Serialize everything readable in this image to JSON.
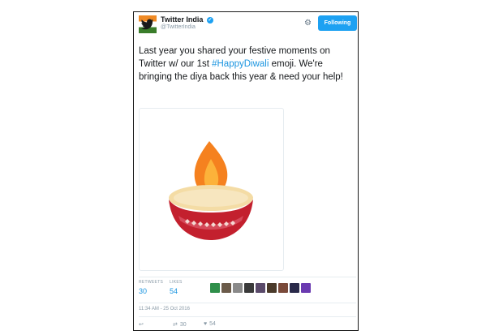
{
  "account": {
    "name": "Twitter India",
    "handle": "@TwitterIndia",
    "follow_label": "Following"
  },
  "tweet": {
    "text_before": "Last year you shared your festive moments on Twitter w/ our 1st ",
    "hashtag": "#HappyDiwali",
    "text_after": " emoji. We're bringing the diya back this year & need your help!"
  },
  "stats": {
    "retweets_label": "RETWEETS",
    "retweets_value": "30",
    "likes_label": "LIKES",
    "likes_value": "54"
  },
  "timestamp": "11:34 AM - 25 Oct 2016",
  "actions": {
    "retweet_count": "30",
    "like_count": "54"
  },
  "colors": {
    "accent": "#1da1f2",
    "link": "#1b95e0",
    "flame_outer": "#f5811f",
    "flame_inner": "#fcb23a",
    "diya_bowl": "#c3202e",
    "diya_rim": "#f4dca5"
  },
  "icons": {
    "settings": "gear-icon",
    "verified": "verified-badge-icon",
    "reply": "reply-icon",
    "retweet": "retweet-icon",
    "like": "heart-icon"
  }
}
